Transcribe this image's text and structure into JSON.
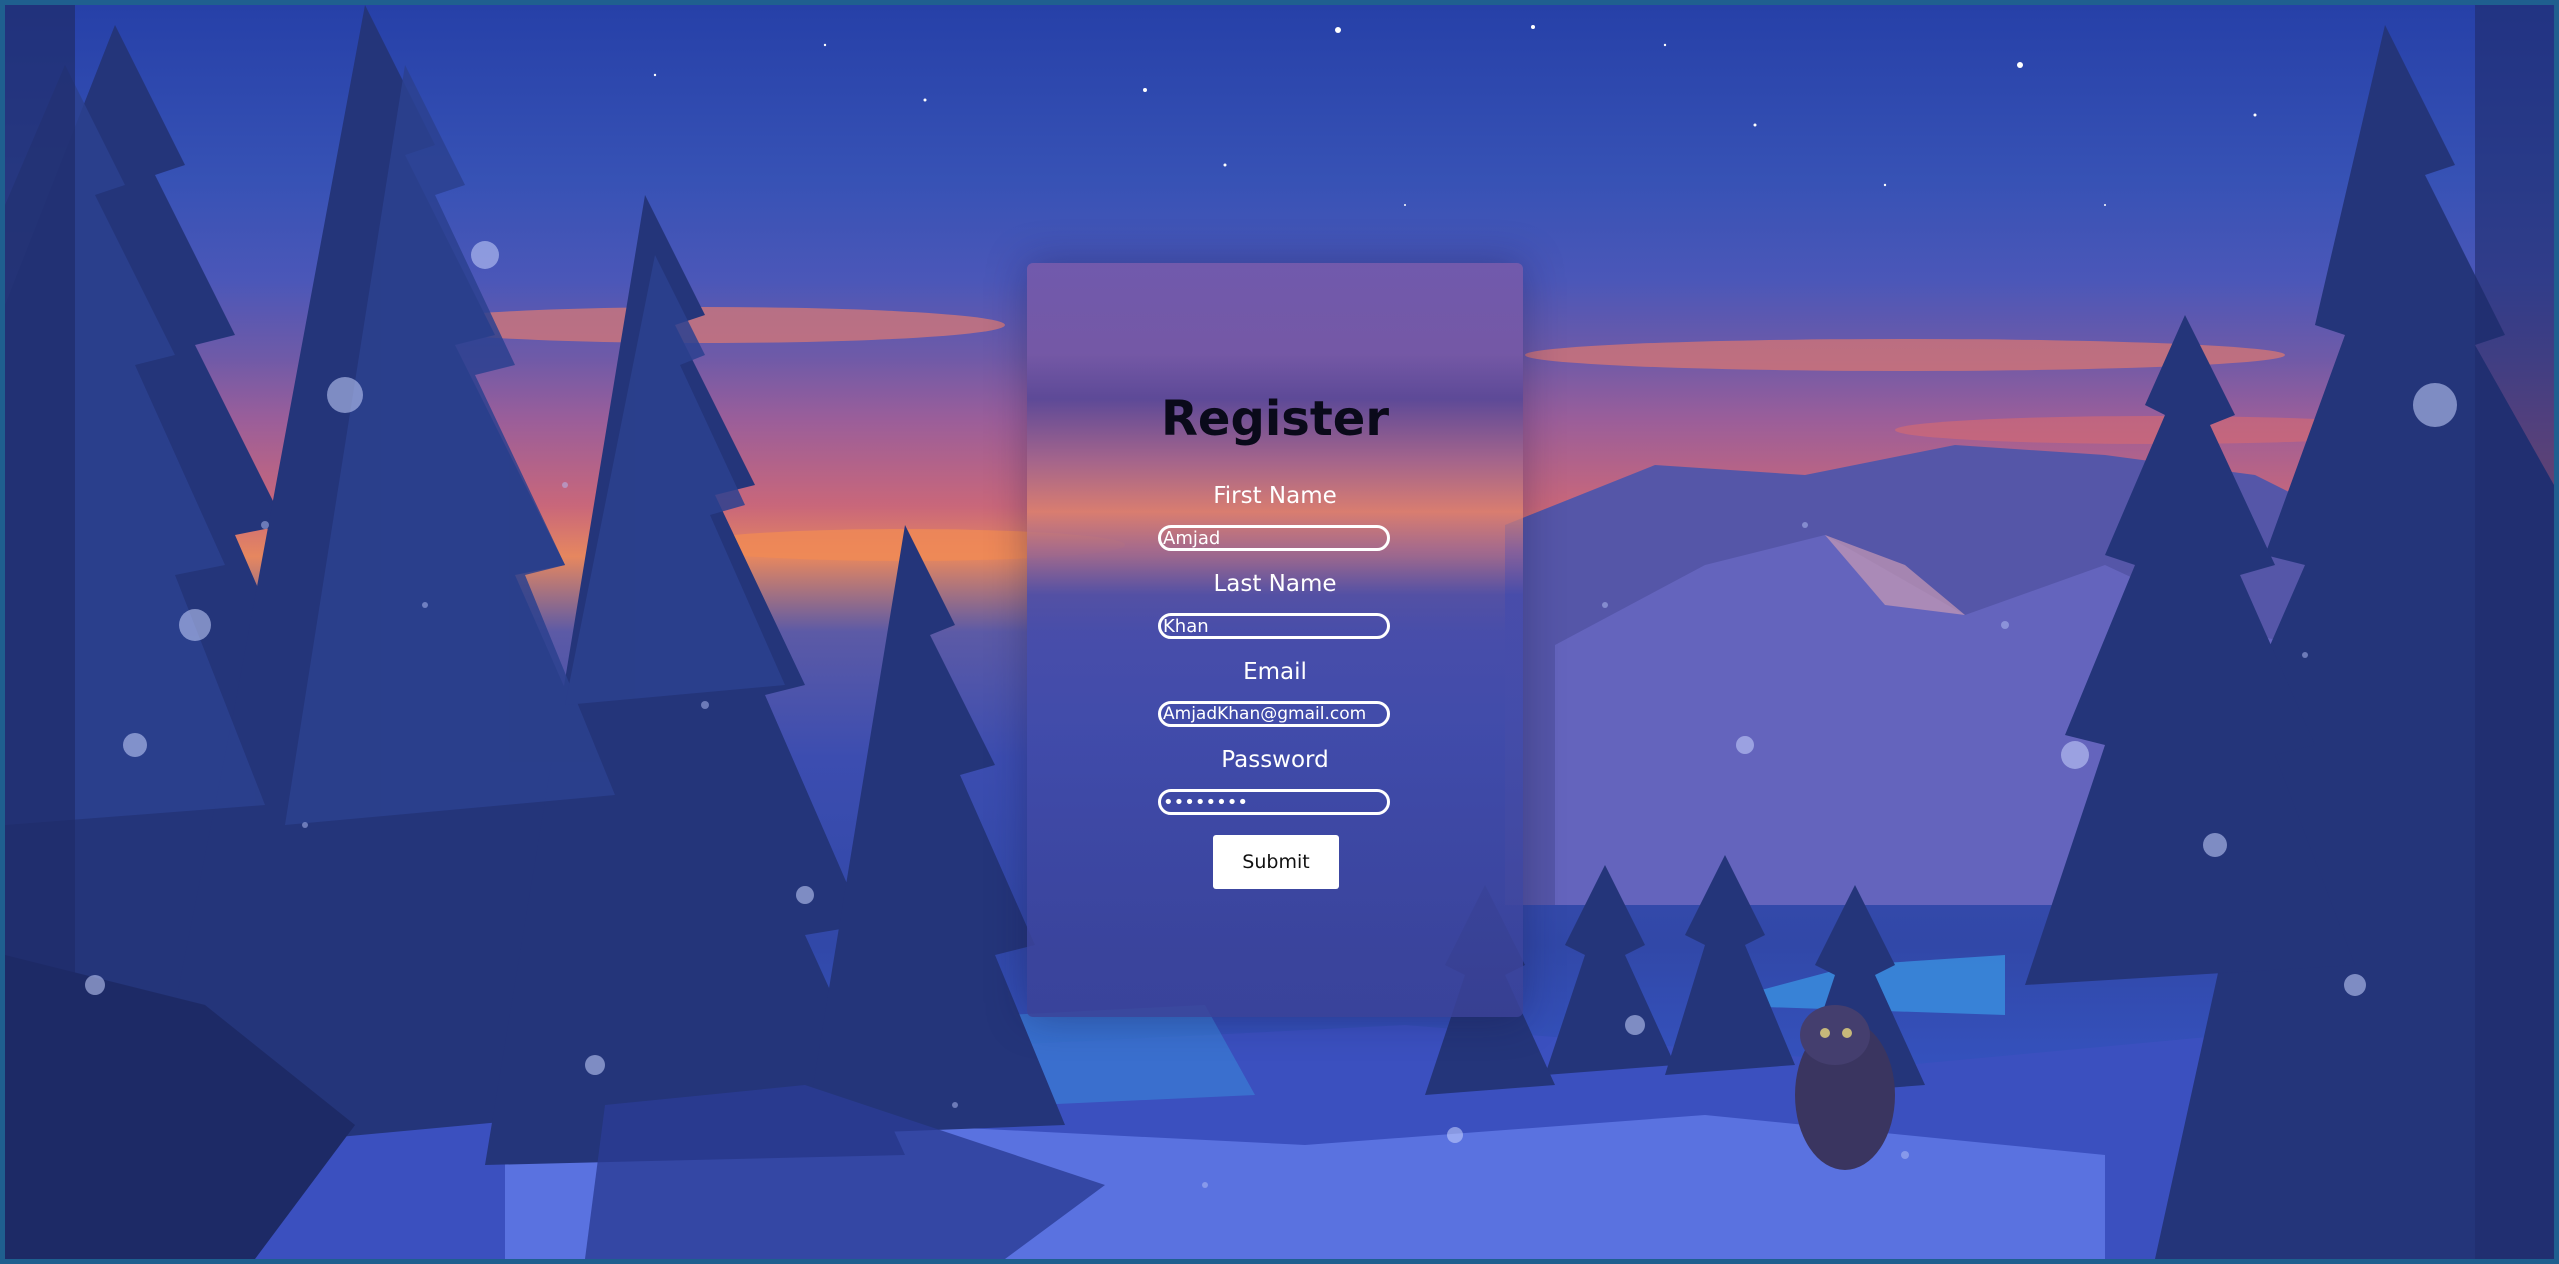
{
  "form": {
    "title": "Register",
    "first_name_label": "First Name",
    "first_name_value": "Amjad",
    "last_name_label": "Last Name",
    "last_name_value": "Khan",
    "email_label": "Email",
    "email_value": "AmjadKhan@gmail.com",
    "password_label": "Password",
    "password_value": "12345678",
    "submit_label": "Submit"
  },
  "colors": {
    "frame_border": "#1f5f8f",
    "card_text": "#ffffff",
    "title_text": "#0a0a1a",
    "button_bg": "#ffffff"
  },
  "background": {
    "scene": "winter-night-forest-illustration"
  }
}
